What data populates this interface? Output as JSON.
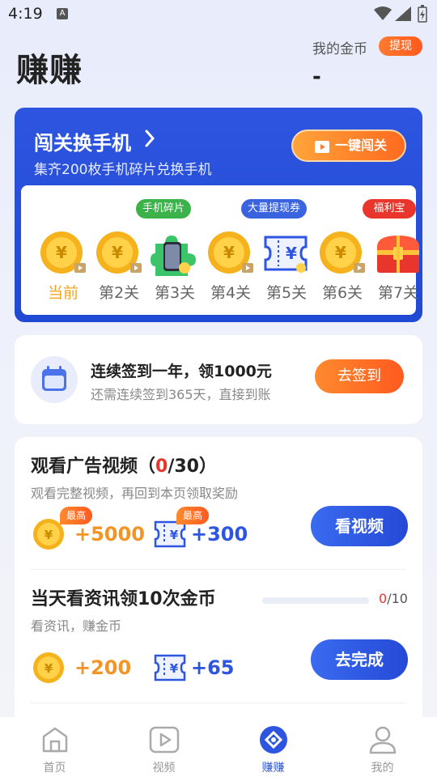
{
  "status_bar": {
    "time": "4:19",
    "notif_badge": "A"
  },
  "header": {
    "title": "赚赚",
    "coins_label": "我的金币",
    "withdraw_label": "提现",
    "coins_value": "-"
  },
  "level_card": {
    "title": "闯关换手机",
    "subtitle": "集齐200枚手机碎片兑换手机",
    "oneclick_label": "一键闯关",
    "levels": [
      {
        "label": "当前",
        "icon": "coin-icon",
        "tag": ""
      },
      {
        "label": "第2关",
        "icon": "coin-icon",
        "tag": ""
      },
      {
        "label": "第3关",
        "icon": "phone-puzzle-icon",
        "tag": "手机碎片"
      },
      {
        "label": "第4关",
        "icon": "coin-icon",
        "tag": ""
      },
      {
        "label": "第5关",
        "icon": "cash-ticket-icon",
        "tag": "大量提现券"
      },
      {
        "label": "第6关",
        "icon": "coin-icon",
        "tag": ""
      },
      {
        "label": "第7关",
        "icon": "treasure-chest-icon",
        "tag": "福利宝箱"
      }
    ]
  },
  "signin": {
    "title": "连续签到一年，领1000元",
    "subtitle": "还需连续签到365天，直接到账",
    "button": "去签到"
  },
  "tasks": {
    "video": {
      "title_prefix": "观看广告视频（",
      "count": "0",
      "title_suffix": "/30）",
      "subtitle": "观看完整视频，再回到本页领取奖励",
      "max_badge": "最高",
      "coin_reward": "+5000",
      "ticket_reward": "+300",
      "button": "看视频"
    },
    "news": {
      "title": "当天看资讯领10次金币",
      "subtitle": "看资讯，赚金币",
      "progress_done": "0",
      "progress_total": "/10",
      "progress_fraction": 0,
      "coin_reward": "+200",
      "ticket_reward": "+65",
      "button": "去完成"
    }
  },
  "bottom_nav": [
    {
      "label": "首页",
      "icon": "home-icon",
      "active": false
    },
    {
      "label": "视频",
      "icon": "video-icon",
      "active": false
    },
    {
      "label": "赚赚",
      "icon": "earn-icon",
      "active": true
    },
    {
      "label": "我的",
      "icon": "profile-icon",
      "active": false
    }
  ],
  "colors": {
    "brand_blue": "#2d55e0",
    "accent_orange": "#ff6a1f",
    "coin_gold": "#f2a526",
    "alert_red": "#e8362c"
  }
}
